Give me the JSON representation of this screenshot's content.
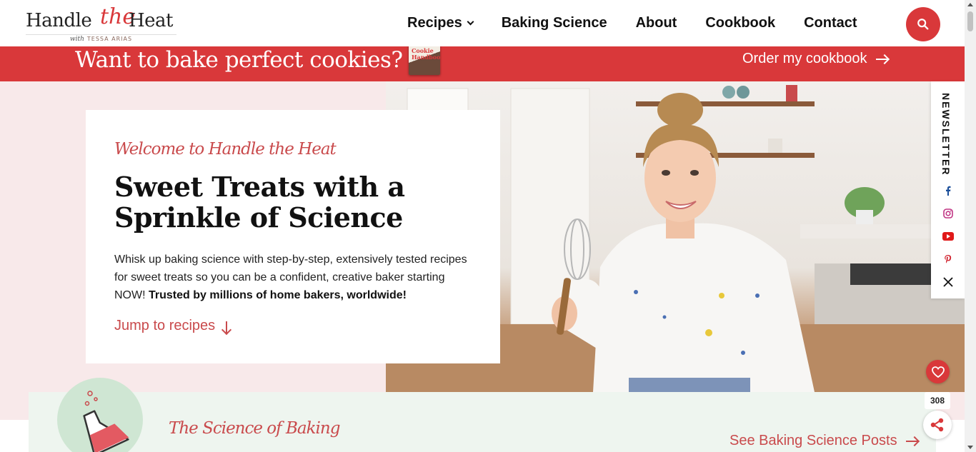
{
  "logo": {
    "word1": "Handle",
    "the": "the",
    "word2": "Heat",
    "with": "with",
    "subtitle": "TESSA ARIAS"
  },
  "nav": {
    "items": [
      {
        "label": "Recipes",
        "has_dropdown": true,
        "icon": "chevron-down-icon"
      },
      {
        "label": "Baking Science"
      },
      {
        "label": "About"
      },
      {
        "label": "Cookbook"
      },
      {
        "label": "Contact"
      }
    ],
    "search_icon": "search-icon"
  },
  "promo": {
    "text": "Want to bake perfect cookies?",
    "book_label": "Cookie Handbook",
    "link": "Order my cookbook"
  },
  "hero": {
    "welcome": "Welcome to Handle the Heat",
    "headline": "Sweet Treats with a Sprinkle of Science",
    "intro_text": "Whisk up baking science with step-by-step, extensively tested recipes for sweet treats so you can be a confident, creative baker starting NOW!",
    "intro_bold": "Trusted by millions of home bakers, worldwide!",
    "jump_link": "Jump to recipes"
  },
  "side_social": {
    "newsletter_label": "NEWSLETTER",
    "icons": [
      "facebook-icon",
      "instagram-icon",
      "youtube-icon",
      "pinterest-icon",
      "x-icon"
    ]
  },
  "science": {
    "title": "The Science of Baking",
    "link": "See Baking Science Posts"
  },
  "widgets": {
    "favorite_icon": "heart-icon",
    "share_count": "308",
    "share_icon": "share-icon"
  },
  "colors": {
    "brand_red": "#d9383a",
    "accent_text": "#c94a4c",
    "hero_pink": "#f8e9ea",
    "science_green": "#eef5ef"
  }
}
